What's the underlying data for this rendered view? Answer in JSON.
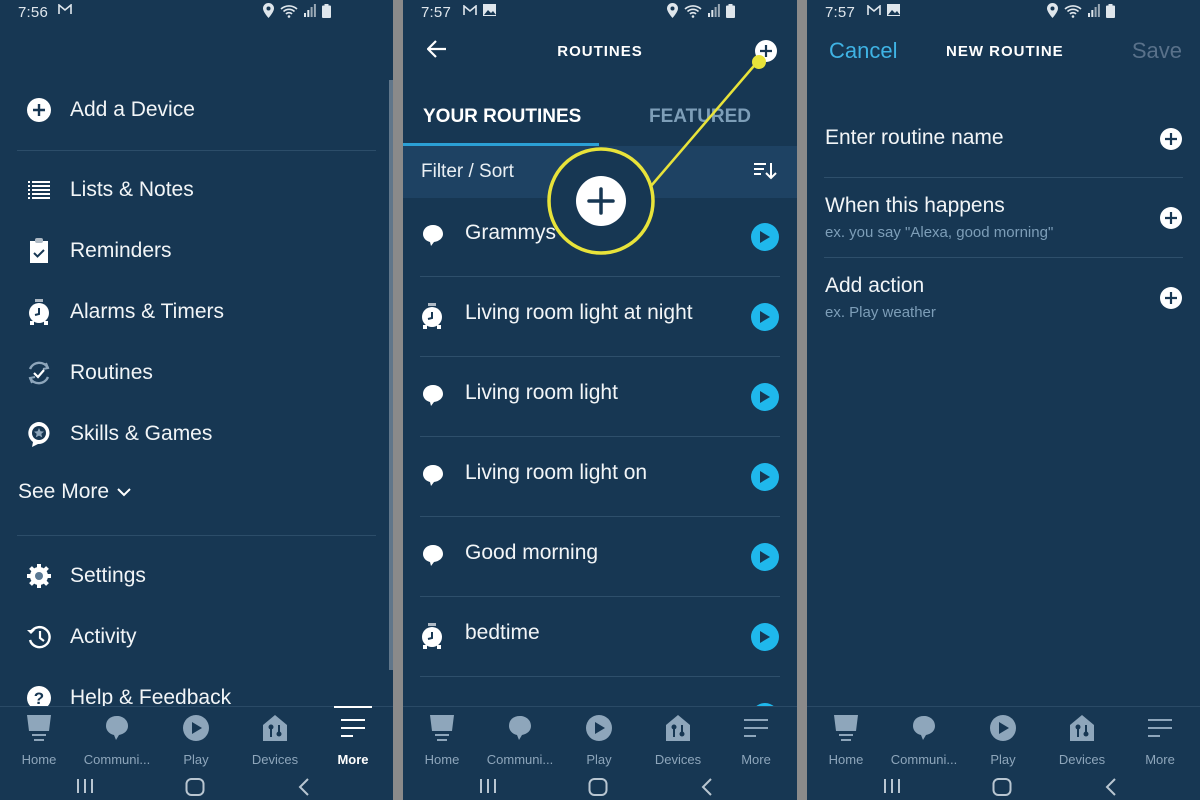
{
  "panels": {
    "menu": {
      "status_time": "7:56",
      "items": [
        {
          "label": "Add a Device",
          "icon": "plus-circle-icon"
        },
        {
          "label": "Lists & Notes",
          "icon": "list-icon"
        },
        {
          "label": "Reminders",
          "icon": "clipboard-check-icon"
        },
        {
          "label": "Alarms & Timers",
          "icon": "alarm-clock-icon"
        },
        {
          "label": "Routines",
          "icon": "routines-icon"
        },
        {
          "label": "Skills & Games",
          "icon": "skills-icon"
        }
      ],
      "see_more": "See More",
      "bottom_items": [
        {
          "label": "Settings",
          "icon": "gear-icon"
        },
        {
          "label": "Activity",
          "icon": "history-icon"
        },
        {
          "label": "Help & Feedback",
          "icon": "help-icon"
        }
      ],
      "active_nav": "More"
    },
    "routines": {
      "status_time": "7:57",
      "title": "ROUTINES",
      "tabs": [
        {
          "label": "YOUR ROUTINES",
          "active": true
        },
        {
          "label": "FEATURED",
          "active": false
        }
      ],
      "filter_label": "Filter / Sort",
      "list": [
        {
          "name": "Grammys routine",
          "visible_text": "Grammys        n",
          "trigger": "voice"
        },
        {
          "name": "Living room light at night",
          "visible_text": "Living room light at night",
          "trigger": "schedule"
        },
        {
          "name": "Living room light",
          "visible_text": "Living room light",
          "trigger": "voice"
        },
        {
          "name": "Living room light on",
          "visible_text": "Living room light on",
          "trigger": "voice"
        },
        {
          "name": "Good morning",
          "visible_text": "Good morning",
          "trigger": "voice"
        },
        {
          "name": "bedtime",
          "visible_text": "bedtime",
          "trigger": "schedule"
        }
      ],
      "callout_color": "#e8e33a"
    },
    "new_routine": {
      "status_time": "7:57",
      "cancel": "Cancel",
      "title": "NEW ROUTINE",
      "save": "Save",
      "rows": [
        {
          "title": "Enter routine name",
          "subtitle": ""
        },
        {
          "title": "When this happens",
          "subtitle": "ex. you say \"Alexa, good morning\""
        },
        {
          "title": "Add action",
          "subtitle": "ex. Play weather"
        }
      ]
    }
  },
  "nav": [
    {
      "label": "Home",
      "icon": "home-icon"
    },
    {
      "label": "Communi...",
      "icon": "communicate-icon"
    },
    {
      "label": "Play",
      "icon": "play-icon"
    },
    {
      "label": "Devices",
      "icon": "devices-icon"
    },
    {
      "label": "More",
      "icon": "more-icon"
    }
  ],
  "colors": {
    "background": "#173753",
    "accent": "#1fb8ec",
    "cancel": "#3fb3e4",
    "inactive": "#7d9eb8"
  }
}
